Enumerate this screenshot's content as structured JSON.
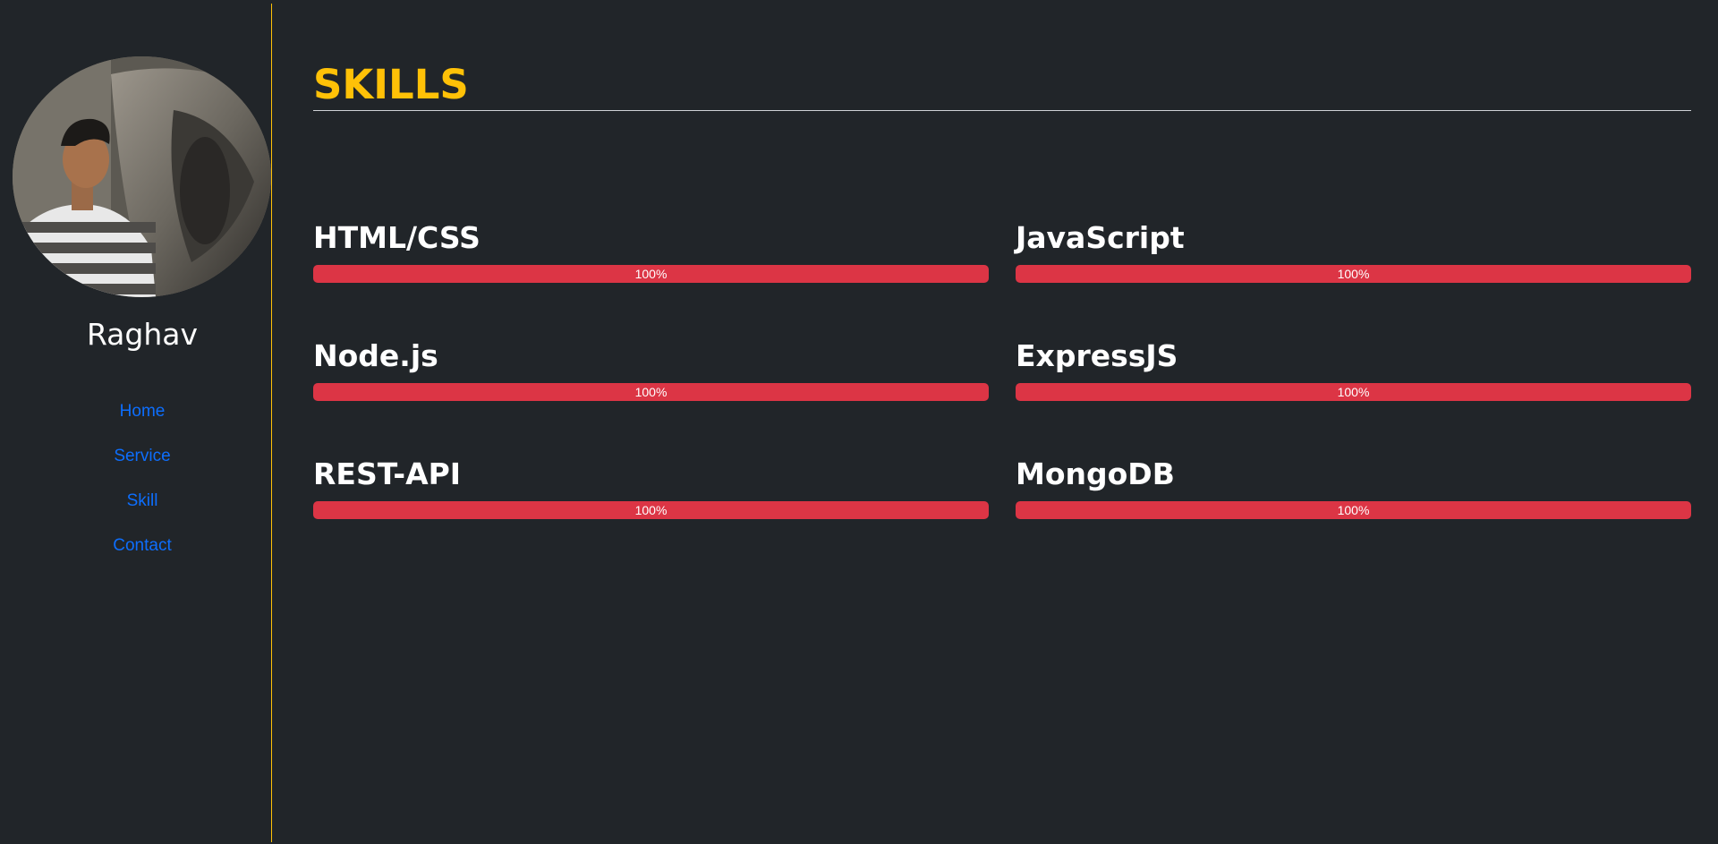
{
  "profile": {
    "name": "Raghav"
  },
  "nav": {
    "items": [
      {
        "label": "Home"
      },
      {
        "label": "Service"
      },
      {
        "label": "Skill"
      },
      {
        "label": "Contact"
      }
    ]
  },
  "skills_section": {
    "title": "SKILLS",
    "skills": [
      {
        "name": "HTML/CSS",
        "level_label": "100%",
        "level": 100
      },
      {
        "name": "JavaScript",
        "level_label": "100%",
        "level": 100
      },
      {
        "name": "Node.js",
        "level_label": "100%",
        "level": 100
      },
      {
        "name": "ExpressJS",
        "level_label": "100%",
        "level": 100
      },
      {
        "name": "REST-API",
        "level_label": "100%",
        "level": 100
      },
      {
        "name": "MongoDB",
        "level_label": "100%",
        "level": 100
      }
    ]
  },
  "colors": {
    "background": "#212529",
    "accent": "#ffc107",
    "link": "#0d6efd",
    "progress": "#dc3545"
  }
}
